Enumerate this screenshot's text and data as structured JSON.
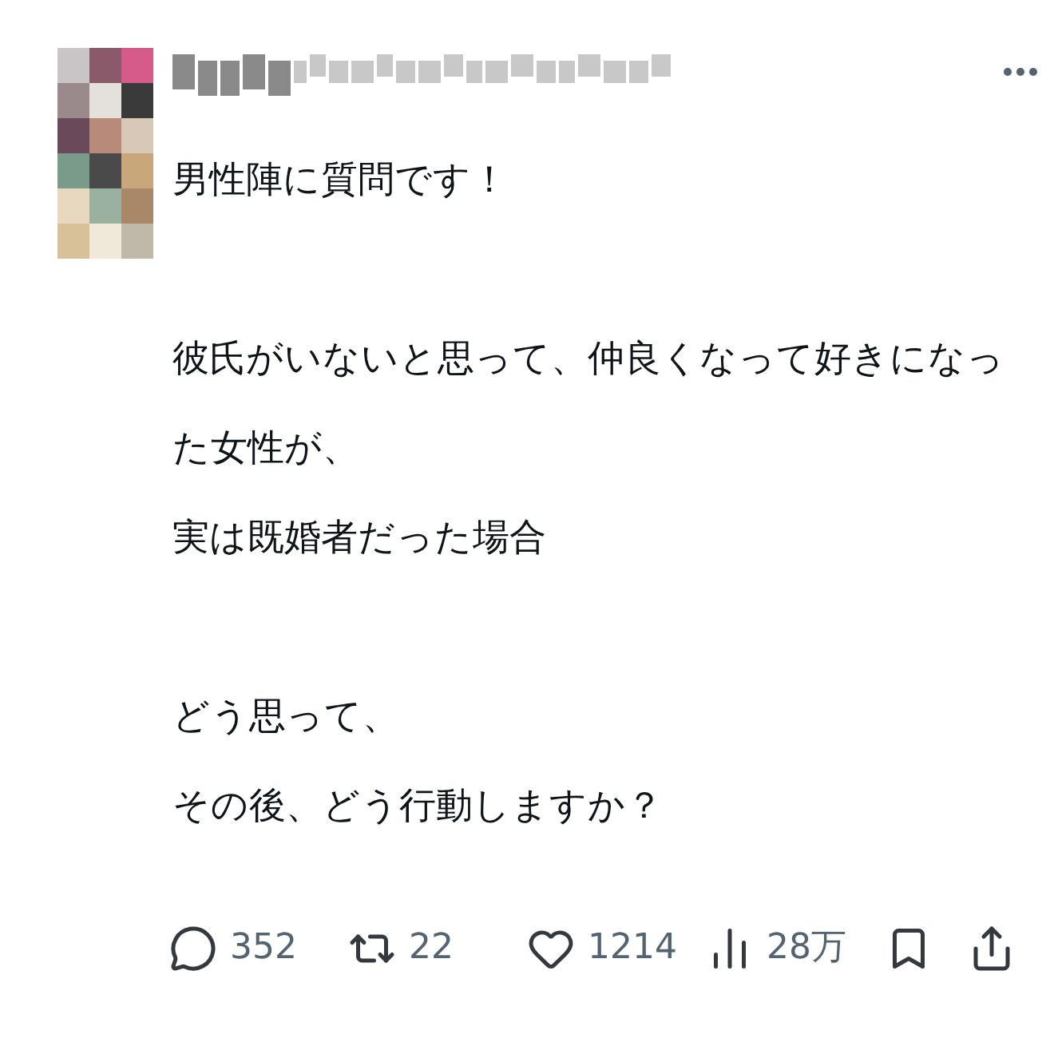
{
  "post": {
    "paragraphs": [
      [
        "男性陣に質問です！"
      ],
      [
        "彼氏がいないと思って、仲良くなって好きになっ",
        "た女性が、",
        "実は既婚者だった場合"
      ],
      [
        "どう思って、",
        "その後、どう行動しますか？"
      ]
    ]
  },
  "actions": [
    {
      "kind": "reply",
      "count": "352"
    },
    {
      "kind": "repost",
      "count": "22"
    },
    {
      "kind": "like",
      "count": "1214"
    },
    {
      "kind": "views",
      "count": "28万"
    },
    {
      "kind": "bookmark"
    },
    {
      "kind": "share"
    }
  ]
}
